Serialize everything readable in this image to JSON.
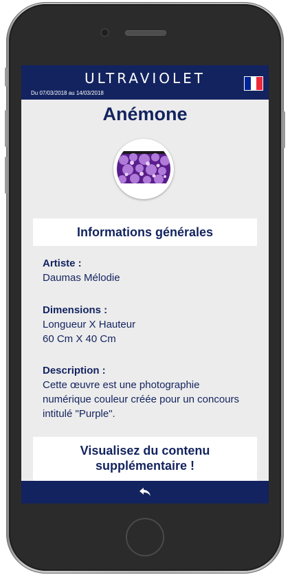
{
  "app": {
    "title": "ULTRAVIOLET",
    "date_range": "Du 07/03/2018 au 14/03/2018",
    "language_flag": {
      "icon": "france-flag-icon",
      "colors": [
        "#002395",
        "#ffffff",
        "#ed2939"
      ]
    }
  },
  "artwork": {
    "title": "Anémone",
    "image_icon": "purple-flower-photo"
  },
  "sections": {
    "general_info_title": "Informations générales",
    "extra_content_line1": "Visualisez du contenu",
    "extra_content_line2": "supplémentaire !"
  },
  "fields": {
    "artist_label": "Artiste :",
    "artist_value": "Daumas Mélodie",
    "dimensions_label": "Dimensions :",
    "dimensions_line1": "Longueur X Hauteur",
    "dimensions_line2": "60 Cm X 40 Cm",
    "description_label": "Description :",
    "description_line1": "Cette œuvre est une photographie",
    "description_line2": "numérique couleur créée pour un concours",
    "description_line3": "intitulé \"Purple\"."
  },
  "footer": {
    "back_icon": "back-arrow-icon"
  },
  "colors": {
    "primary": "#13235f",
    "background": "#ececec",
    "card": "#ffffff"
  }
}
